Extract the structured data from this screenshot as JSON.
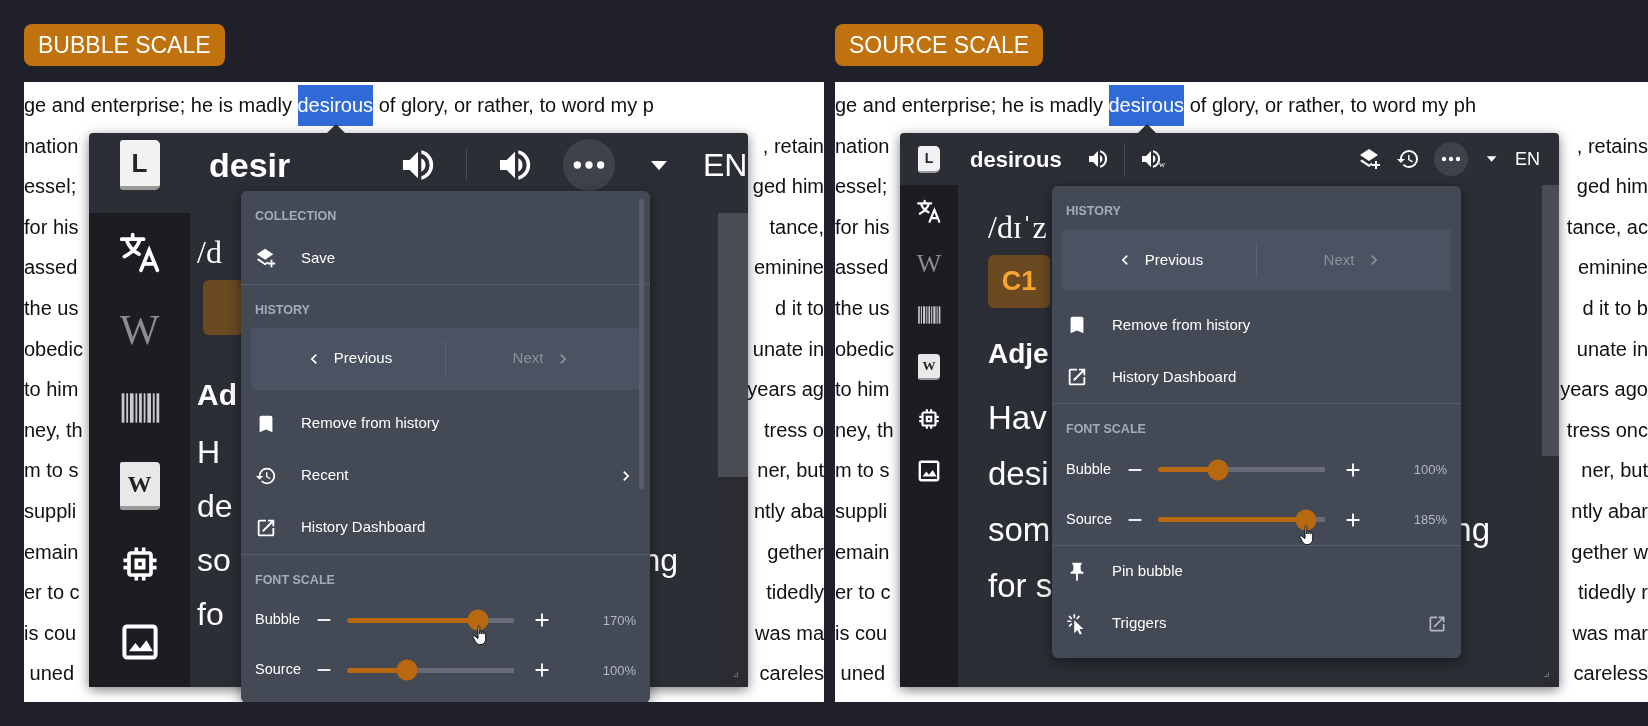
{
  "panels": [
    {
      "label": "BUBBLE SCALE",
      "page": {
        "first_line": {
          "before": "ge and enterprise; he is madly ",
          "selected": "desirous",
          "after": " of glory, or rather, to word my p"
        },
        "lines": [
          {
            "left": "nation",
            "right": ", retain"
          },
          {
            "left": "essel;",
            "right": "ged him"
          },
          {
            "left": "for his",
            "right": "tance,"
          },
          {
            "left": "assed",
            "right": "eminine"
          },
          {
            "left": "the us",
            "right": "d it to"
          },
          {
            "left": "obedic",
            "right": "unate in"
          },
          {
            "left": "to him",
            "right": "years ag"
          },
          {
            "left": "ney, th",
            "right": "tress o"
          },
          {
            "left": "m to s",
            "right": "ner, but"
          },
          {
            "left": "suppli",
            "right": "ntly aba"
          },
          {
            "left": "emain",
            "right": "gether"
          },
          {
            "left": "er to c",
            "right": "tidedly"
          },
          {
            "left": "is cou",
            "right": "was ma"
          },
          {
            "left": " uned",
            "right": "careles"
          }
        ]
      },
      "bubble": {
        "logo": "L",
        "word": "desir",
        "tools": [
          {
            "kind": "speaker"
          },
          {
            "kind": "divider"
          },
          {
            "kind": "speaker"
          },
          {
            "kind": "more"
          },
          {
            "kind": "caret"
          }
        ],
        "language": "EN",
        "sidebar": [
          {
            "kind": "translate"
          },
          {
            "kind": "wiki",
            "glyph": "W"
          },
          {
            "kind": "barcode"
          },
          {
            "kind": "wikibook",
            "glyph": "W"
          },
          {
            "kind": "chip"
          },
          {
            "kind": "image"
          }
        ],
        "phonetic": "/d",
        "part_of_speech": "Ad",
        "definition": [
          {
            "left": "H"
          },
          {
            "left": "de"
          },
          {
            "left": "so",
            "right": "ng"
          },
          {
            "left": "fo"
          }
        ],
        "menu": {
          "groups": [
            [
              {
                "kind": "heading",
                "label": "COLLECTION"
              },
              {
                "kind": "save",
                "label": "Save"
              }
            ],
            [
              {
                "kind": "heading",
                "label": "HISTORY"
              },
              {
                "kind": "pager",
                "previous": {
                  "label": "Previous",
                  "disabled": false
                },
                "next": {
                  "label": "Next",
                  "disabled": true
                }
              },
              {
                "kind": "bookmark",
                "label": "Remove from history"
              },
              {
                "kind": "recent",
                "label": "Recent"
              },
              {
                "kind": "dashboard",
                "label": "History Dashboard"
              }
            ],
            [
              {
                "kind": "heading",
                "label": "FONT SCALE"
              },
              {
                "kind": "slider",
                "label": "Bubble",
                "level": 0.76,
                "reading": "170%",
                "cursor": true
              },
              {
                "kind": "slider",
                "label": "Source",
                "level": 0.35,
                "reading": "100%",
                "cursor": false
              }
            ]
          ]
        }
      }
    },
    {
      "label": "SOURCE SCALE",
      "page": {
        "first_line": {
          "before": "ge and enterprise; he is madly ",
          "selected": "desirous",
          "after": " of glory, or rather, to word my ph"
        },
        "lines": [
          {
            "left": "nation",
            "right": ", retains"
          },
          {
            "left": "essel;",
            "right": "ged him"
          },
          {
            "left": "for his",
            "right": "tance, ac"
          },
          {
            "left": "assed",
            "right": "eminine"
          },
          {
            "left": "the us",
            "right": "d it to b"
          },
          {
            "left": "obedic",
            "right": "unate in"
          },
          {
            "left": "to him",
            "right": "years ago"
          },
          {
            "left": "ney, th",
            "right": "tress onc"
          },
          {
            "left": "m to s",
            "right": "ner, but"
          },
          {
            "left": "suppli",
            "right": "ntly abar"
          },
          {
            "left": "emain",
            "right": "gether w"
          },
          {
            "left": "er to c",
            "right": "tidedly r"
          },
          {
            "left": "is cou",
            "right": "was mar"
          },
          {
            "left": " uned",
            "right": "careless"
          }
        ]
      },
      "bubble": {
        "logo": "L",
        "word": "desirous",
        "tools": [
          {
            "kind": "speaker"
          },
          {
            "kind": "divider"
          },
          {
            "kind": "speaker",
            "sub": "w"
          },
          {
            "kind": "spacer"
          },
          {
            "kind": "save"
          },
          {
            "kind": "history"
          },
          {
            "kind": "more"
          },
          {
            "kind": "caret"
          }
        ],
        "language": "EN",
        "sidebar": [
          {
            "kind": "translate"
          },
          {
            "kind": "wiki",
            "glyph": "W"
          },
          {
            "kind": "barcode"
          },
          {
            "kind": "wikibook",
            "glyph": "W"
          },
          {
            "kind": "chip"
          },
          {
            "kind": "image"
          }
        ],
        "phonetic": "/dɪˈz",
        "badge": "C1",
        "part_of_speech": "Adje",
        "definition": [
          {
            "left": "Hav"
          },
          {
            "left": "desi"
          },
          {
            "left": "som",
            "right": "ng"
          },
          {
            "left": "for s"
          }
        ],
        "menu": {
          "groups": [
            [
              {
                "kind": "heading",
                "label": "HISTORY"
              },
              {
                "kind": "pager",
                "previous": {
                  "label": "Previous",
                  "disabled": false
                },
                "next": {
                  "label": "Next",
                  "disabled": true
                }
              },
              {
                "kind": "bookmark",
                "label": "Remove from history"
              },
              {
                "kind": "dashboard",
                "label": "History Dashboard"
              }
            ],
            [
              {
                "kind": "heading",
                "label": "FONT SCALE"
              },
              {
                "kind": "slider",
                "label": "Bubble",
                "level": 0.35,
                "reading": "100%",
                "cursor": false
              },
              {
                "kind": "slider",
                "label": "Source",
                "level": 0.86,
                "reading": "185%",
                "cursor": true
              }
            ],
            [
              {
                "kind": "pin",
                "label": "Pin bubble"
              },
              {
                "kind": "triggers",
                "label": "Triggers"
              }
            ]
          ]
        }
      }
    }
  ]
}
